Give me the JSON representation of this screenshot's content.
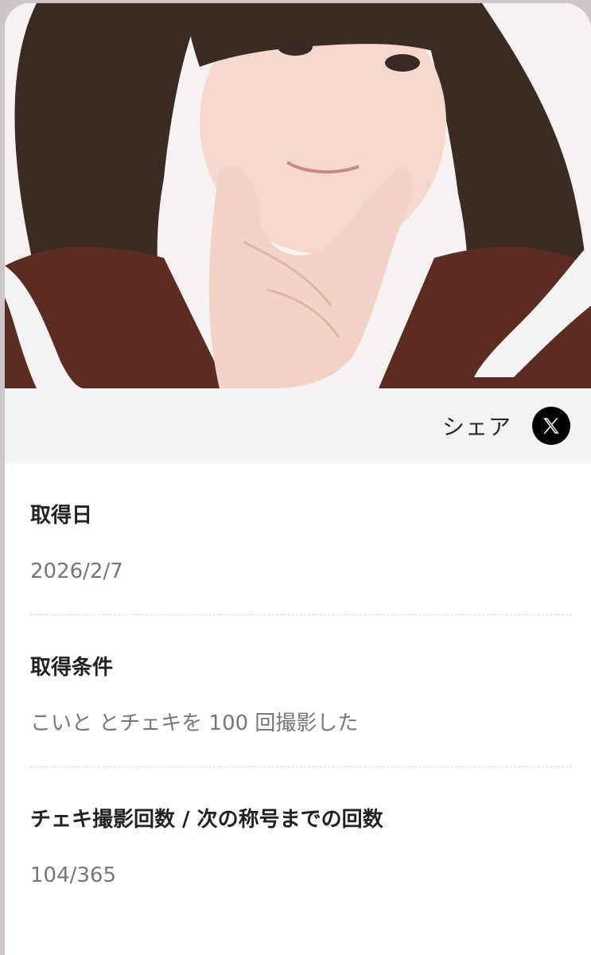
{
  "share": {
    "label": "シェア",
    "icon": "x-logo-icon"
  },
  "fields": [
    {
      "label": "取得日",
      "value": "2026/2/7"
    },
    {
      "label": "取得条件",
      "value": "こいと とチェキを 100 回撮影した"
    },
    {
      "label": "チェキ撮影回数 / 次の称号までの回数",
      "value": "104/365"
    }
  ],
  "colors": {
    "card_background": "#ffffff",
    "share_bar_background": "#f3f3f3",
    "label_text": "#222222",
    "value_text": "#777777",
    "divider": "#c9dde3",
    "x_button": "#000000"
  }
}
